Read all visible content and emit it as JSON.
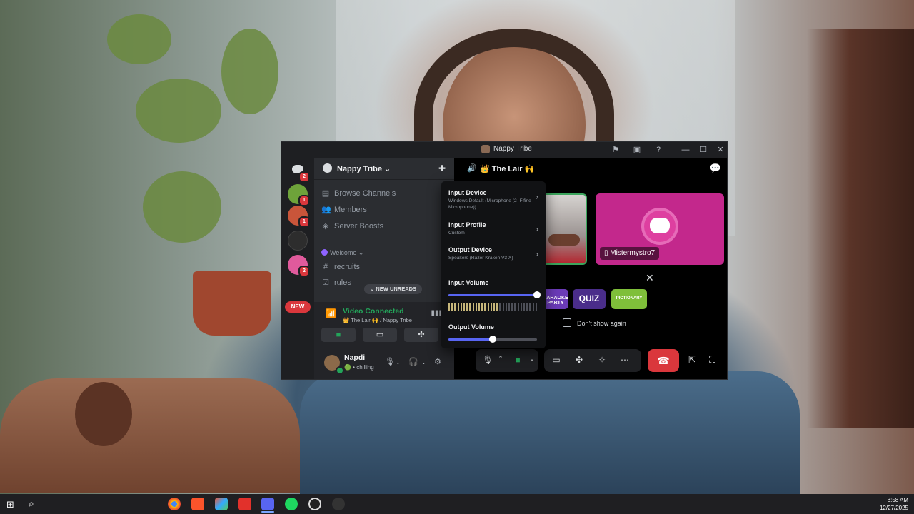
{
  "window": {
    "title": "Nappy Tribe",
    "titlebar_icons": [
      "flag-icon",
      "inbox-icon",
      "help-icon",
      "minimize-icon",
      "maximize-icon",
      "close-icon"
    ]
  },
  "server_rail": {
    "home_badge": "2",
    "servers": [
      {
        "name": "server-1",
        "badge": "1",
        "color": "#6ea33a"
      },
      {
        "name": "server-2",
        "badge": "1",
        "color": "#c9553a"
      },
      {
        "name": "server-3",
        "badge": "",
        "color": "#2d2d2d"
      },
      {
        "name": "server-4",
        "badge": "2",
        "color": "#e05a9c"
      }
    ],
    "new_label": "NEW"
  },
  "channels": {
    "server_name": "Nappy Tribe",
    "nav": [
      {
        "label": "Browse Channels",
        "icon": "browse-icon"
      },
      {
        "label": "Members",
        "icon": "members-icon"
      },
      {
        "label": "Server Boosts",
        "icon": "boost-icon"
      }
    ],
    "category": "Welcome",
    "items": [
      {
        "label": "recruits",
        "icon": "#"
      },
      {
        "label": "rules",
        "icon": "☑"
      }
    ],
    "new_unreads": "NEW UNREADS"
  },
  "voice": {
    "status": "Video Connected",
    "location": "👑 The Lair 🙌 / Nappy Tribe"
  },
  "user": {
    "name": "Napdi",
    "status": "chilling"
  },
  "stage": {
    "channel": "👑 The Lair 🙌",
    "participant": "Mistermystro7",
    "activities": [
      "KARAOKE PARTY",
      "QUIZ",
      "PICTIONARY"
    ],
    "dont_show": "Don't show again"
  },
  "menu": {
    "input_device": {
      "label": "Input Device",
      "value": "Windows Default (Microphone (2- Fifine Microphone))"
    },
    "input_profile": {
      "label": "Input Profile",
      "value": "Custom"
    },
    "output_device": {
      "label": "Output Device",
      "value": "Speakers (Razer Kraken V3 X)"
    },
    "input_volume": {
      "label": "Input Volume",
      "value": 1.0
    },
    "output_volume": {
      "label": "Output Volume",
      "value": 0.5
    },
    "input_meter_level": 0.55
  },
  "colors": {
    "accent": "#5865f2",
    "online": "#23a55a",
    "danger": "#da373c",
    "tile_pink": "#c3288c"
  },
  "taskbar": {
    "time": "8:58 AM",
    "date": "12/27/2025",
    "apps": [
      "chrome-icon",
      "brave-icon",
      "creative-cloud-icon",
      "anydesk-icon",
      "discord-icon",
      "spotify-icon",
      "media-player-icon",
      "obs-icon"
    ]
  }
}
